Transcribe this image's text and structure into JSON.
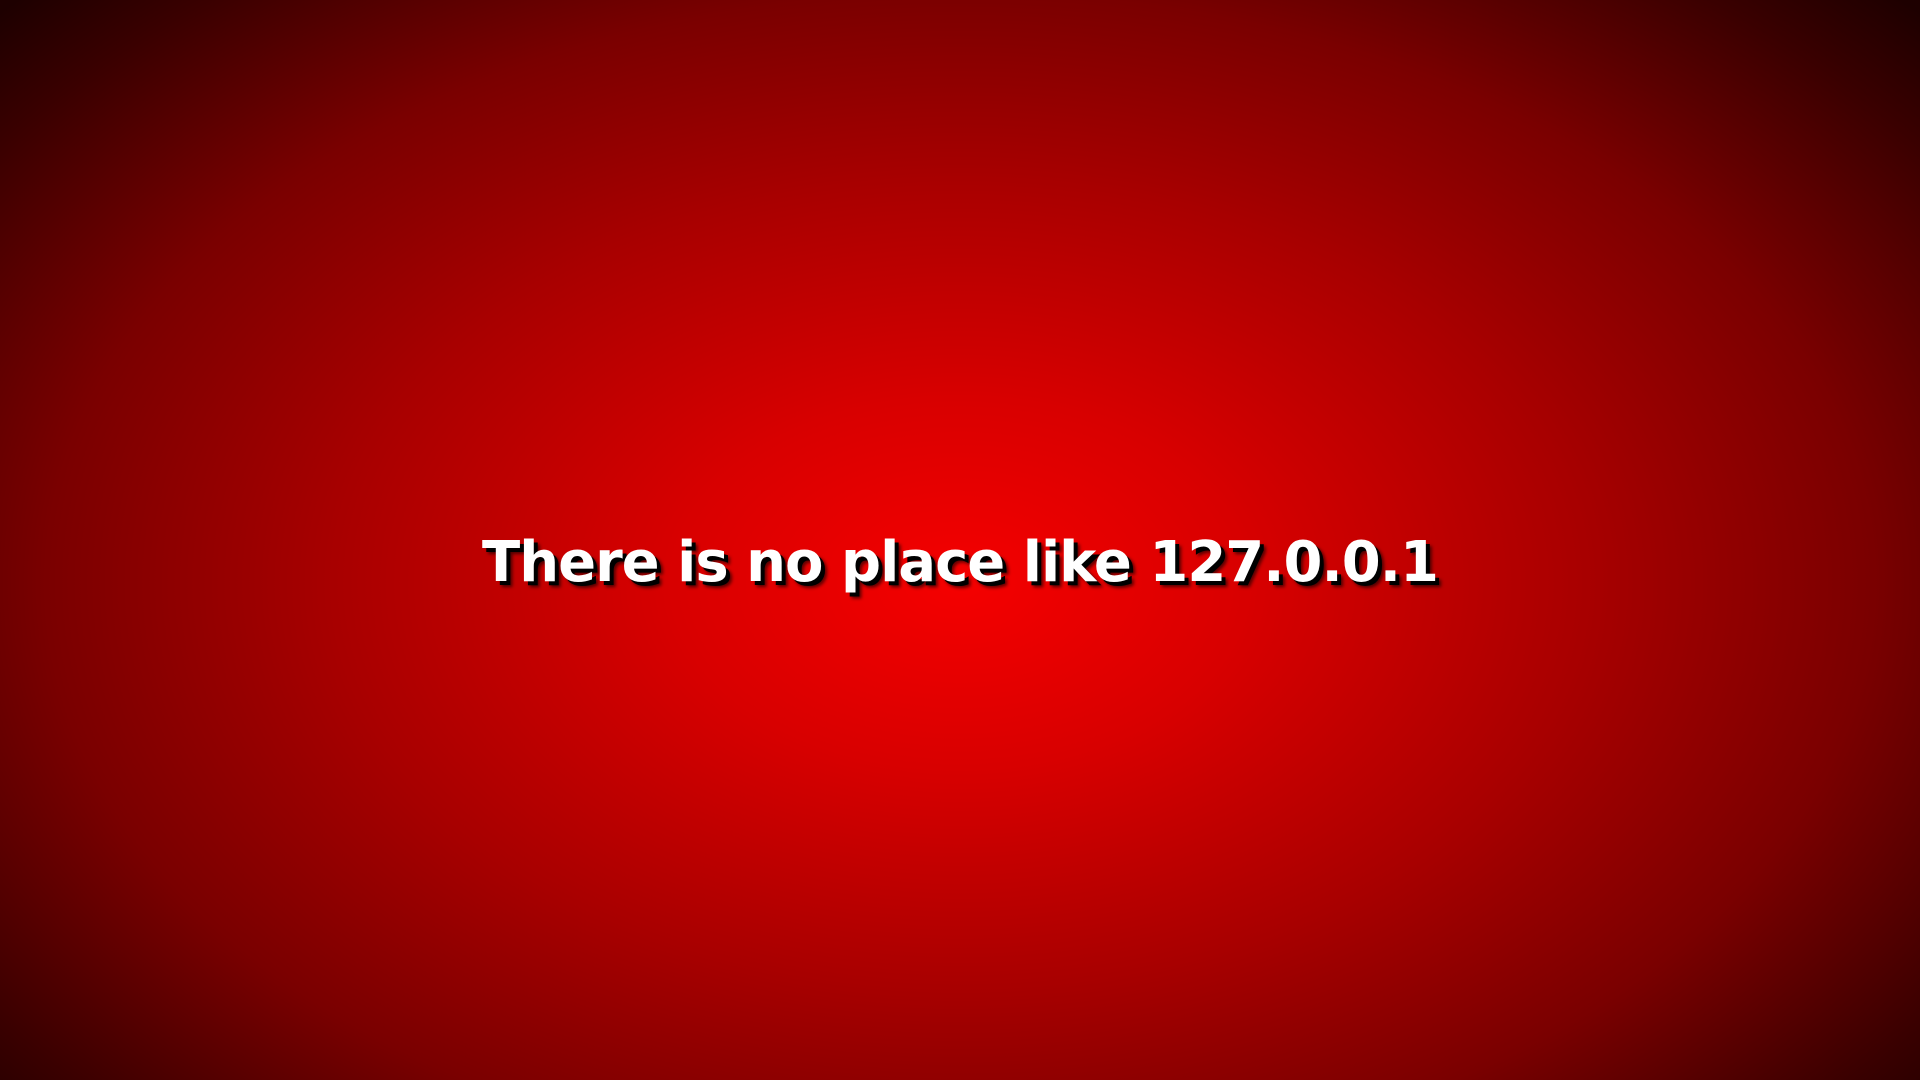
{
  "desktop": {
    "headline": "There is no place like 127.0.0.1"
  },
  "colors": {
    "center": "#f50000",
    "edge": "#1e0000",
    "text": "#ffffff",
    "text_shadow": "#000000"
  }
}
